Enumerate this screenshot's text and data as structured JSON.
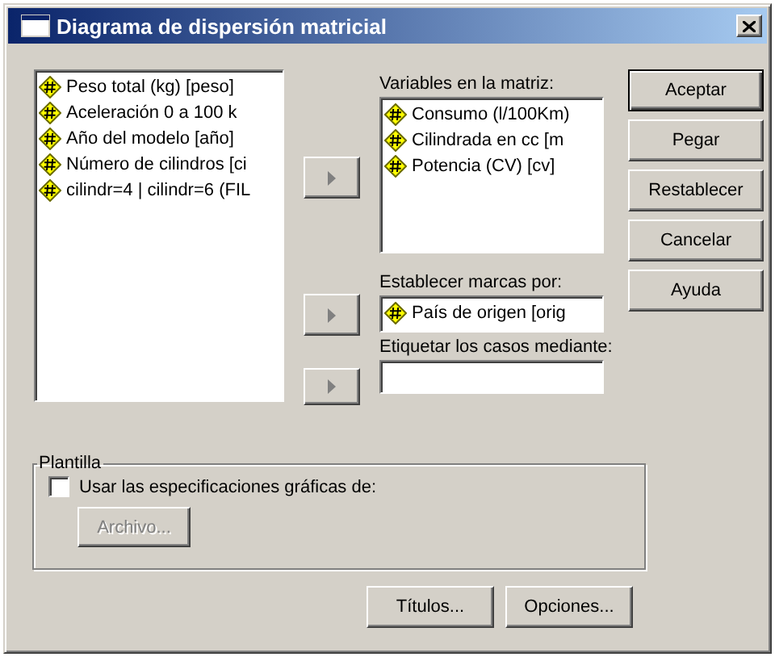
{
  "window": {
    "title": "Diagrama de dispersión matricial"
  },
  "source_list": {
    "items": [
      {
        "label": "Peso total (kg) [peso]"
      },
      {
        "label": "Aceleración 0 a 100 k"
      },
      {
        "label": "Año del modelo [año]"
      },
      {
        "label": "Número de cilindros [ci"
      },
      {
        "label": "cilindr=4 | cilindr=6 (FIL"
      }
    ]
  },
  "move_buttons": [
    {
      "disabled": true
    },
    {
      "disabled": true
    },
    {
      "disabled": true
    }
  ],
  "matrix_variables": {
    "label": "Variables en la matriz:",
    "items": [
      {
        "label": "Consumo (l/100Km)"
      },
      {
        "label": "Cilindrada en cc [m"
      },
      {
        "label": "Potencia (CV) [cv]"
      }
    ]
  },
  "markers": {
    "label": "Establecer marcas por:",
    "value": "País de origen [orig"
  },
  "case_labels": {
    "label": "Etiquetar los casos mediante:"
  },
  "buttons": [
    {
      "label": "Aceptar",
      "default": true
    },
    {
      "label": "Pegar",
      "default": false
    },
    {
      "label": "Restablecer",
      "default": false
    },
    {
      "label": "Cancelar",
      "default": false
    },
    {
      "label": "Ayuda",
      "default": false
    }
  ],
  "template": {
    "title": "Plantilla",
    "checkbox": {
      "label": "Usar las especificaciones gráficas de:",
      "checked": false
    },
    "file_button": {
      "label": "Archivo...",
      "disabled": true
    }
  },
  "bottom_buttons": [
    {
      "label": "Títulos..."
    },
    {
      "label": "Opciones..."
    }
  ]
}
